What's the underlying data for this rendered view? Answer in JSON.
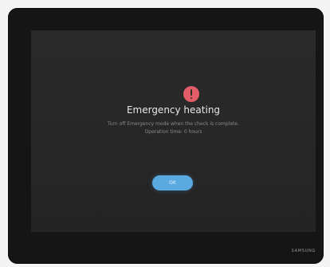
{
  "dialog": {
    "title": "Emergency heating",
    "message_line_1": "Turn off Emergency mode when the check is complete.",
    "message_line_2": "Operation time: 0 hours",
    "ok_label": "OK",
    "icon": "exclamation-icon"
  },
  "device": {
    "brand": "SAMSUNG"
  },
  "colors": {
    "accent": "#5aa9e0",
    "alert": "#e15d67",
    "screen_bg": "#2a2a2a",
    "frame": "#151515"
  }
}
